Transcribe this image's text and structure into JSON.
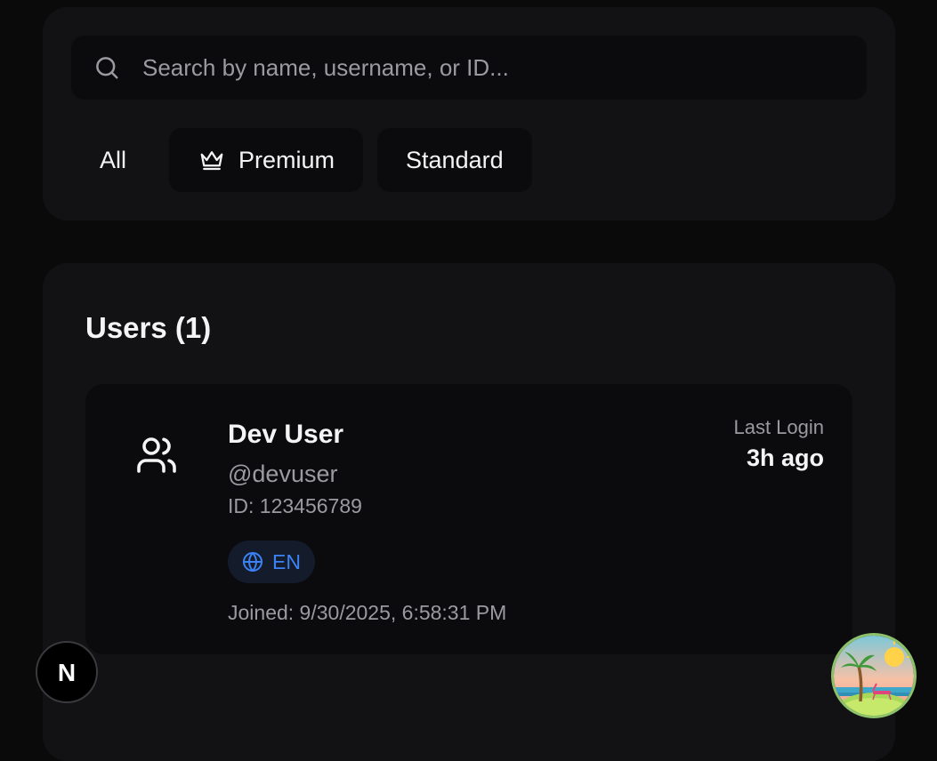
{
  "search": {
    "placeholder": "Search by name, username, or ID...",
    "value": ""
  },
  "filters": [
    {
      "label": "All",
      "icon": null
    },
    {
      "label": "Premium",
      "icon": "crown-icon"
    },
    {
      "label": "Standard",
      "icon": null
    }
  ],
  "users_section": {
    "title": "Users (1)",
    "users": [
      {
        "name": "Dev User",
        "username": "@devuser",
        "id_text": "ID: 123456789",
        "language": "EN",
        "joined": "Joined: 9/30/2025, 6:58:31 PM",
        "last_login_label": "Last Login",
        "last_login_value": "3h ago",
        "icon": "users-icon"
      }
    ]
  },
  "overlays": {
    "dev_badge_letter": "N",
    "dev_badge_icon": "nextjs-logo-icon",
    "profile_avatar_icon": "beach-avatar-icon"
  },
  "colors": {
    "background": "#0a0a0b",
    "panel": "#121214",
    "accent_blue": "#3b82f6",
    "muted_text": "#9a9aa0"
  }
}
